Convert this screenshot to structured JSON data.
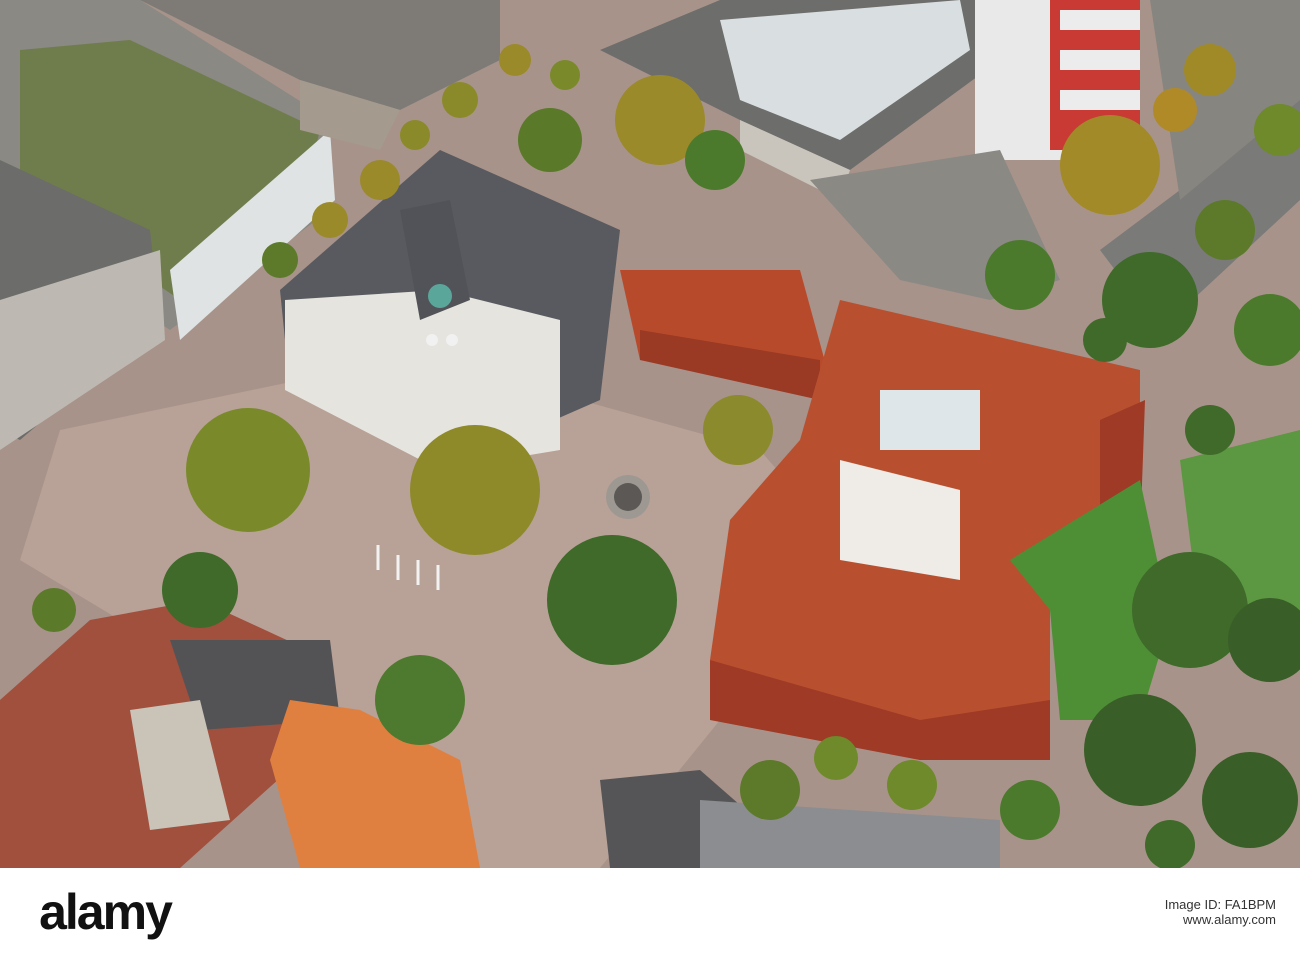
{
  "photo": {
    "scene": "aerial-city-square",
    "colors": {
      "pavement": "#b09584",
      "redroof": "#b34a2c",
      "redwall": "#a83a24",
      "whitehall": "#e4e2dc",
      "slate": "#5b5b5e",
      "tree": "#557a2c",
      "grass": "#4a8a33",
      "concrete": "#8f8c87"
    }
  },
  "banner_text": "",
  "footer": {
    "logo": "alamy",
    "image_id_label": "Image ID: FA1BPM",
    "image_id": "FA1BPM",
    "url": "www.alamy.com"
  }
}
